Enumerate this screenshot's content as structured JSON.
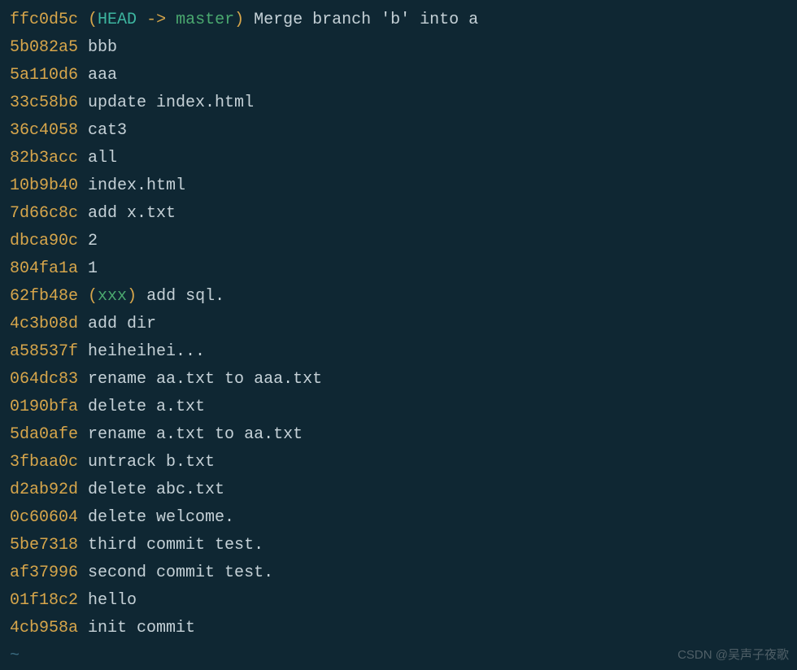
{
  "commits": [
    {
      "hash": "ffc0d5c",
      "ref": {
        "head": "HEAD",
        "arrow": " -> ",
        "branch": "master"
      },
      "message": "Merge branch 'b' into a"
    },
    {
      "hash": "5b082a5",
      "message": "bbb"
    },
    {
      "hash": "5a110d6",
      "message": "aaa"
    },
    {
      "hash": "33c58b6",
      "message": "update index.html"
    },
    {
      "hash": "36c4058",
      "message": "cat3"
    },
    {
      "hash": "82b3acc",
      "message": "all"
    },
    {
      "hash": "10b9b40",
      "message": "index.html"
    },
    {
      "hash": "7d66c8c",
      "message": "add x.txt"
    },
    {
      "hash": "dbca90c",
      "message": "2"
    },
    {
      "hash": "804fa1a",
      "message": "1"
    },
    {
      "hash": "62fb48e",
      "ref": {
        "branch": "xxx"
      },
      "message": "add sql."
    },
    {
      "hash": "4c3b08d",
      "message": "add dir"
    },
    {
      "hash": "a58537f",
      "message": "heiheihei..."
    },
    {
      "hash": "064dc83",
      "message": "rename aa.txt to aaa.txt"
    },
    {
      "hash": "0190bfa",
      "message": "delete a.txt"
    },
    {
      "hash": "5da0afe",
      "message": "rename a.txt to aa.txt"
    },
    {
      "hash": "3fbaa0c",
      "message": "untrack b.txt"
    },
    {
      "hash": "d2ab92d",
      "message": "delete abc.txt"
    },
    {
      "hash": "0c60604",
      "message": "delete welcome."
    },
    {
      "hash": "5be7318",
      "message": "third commit test."
    },
    {
      "hash": "af37996",
      "message": "second commit test."
    },
    {
      "hash": "01f18c2",
      "message": "hello"
    },
    {
      "hash": "4cb958a",
      "message": "init commit"
    }
  ],
  "tilde": "~",
  "watermark": "CSDN @吴声子夜歌"
}
